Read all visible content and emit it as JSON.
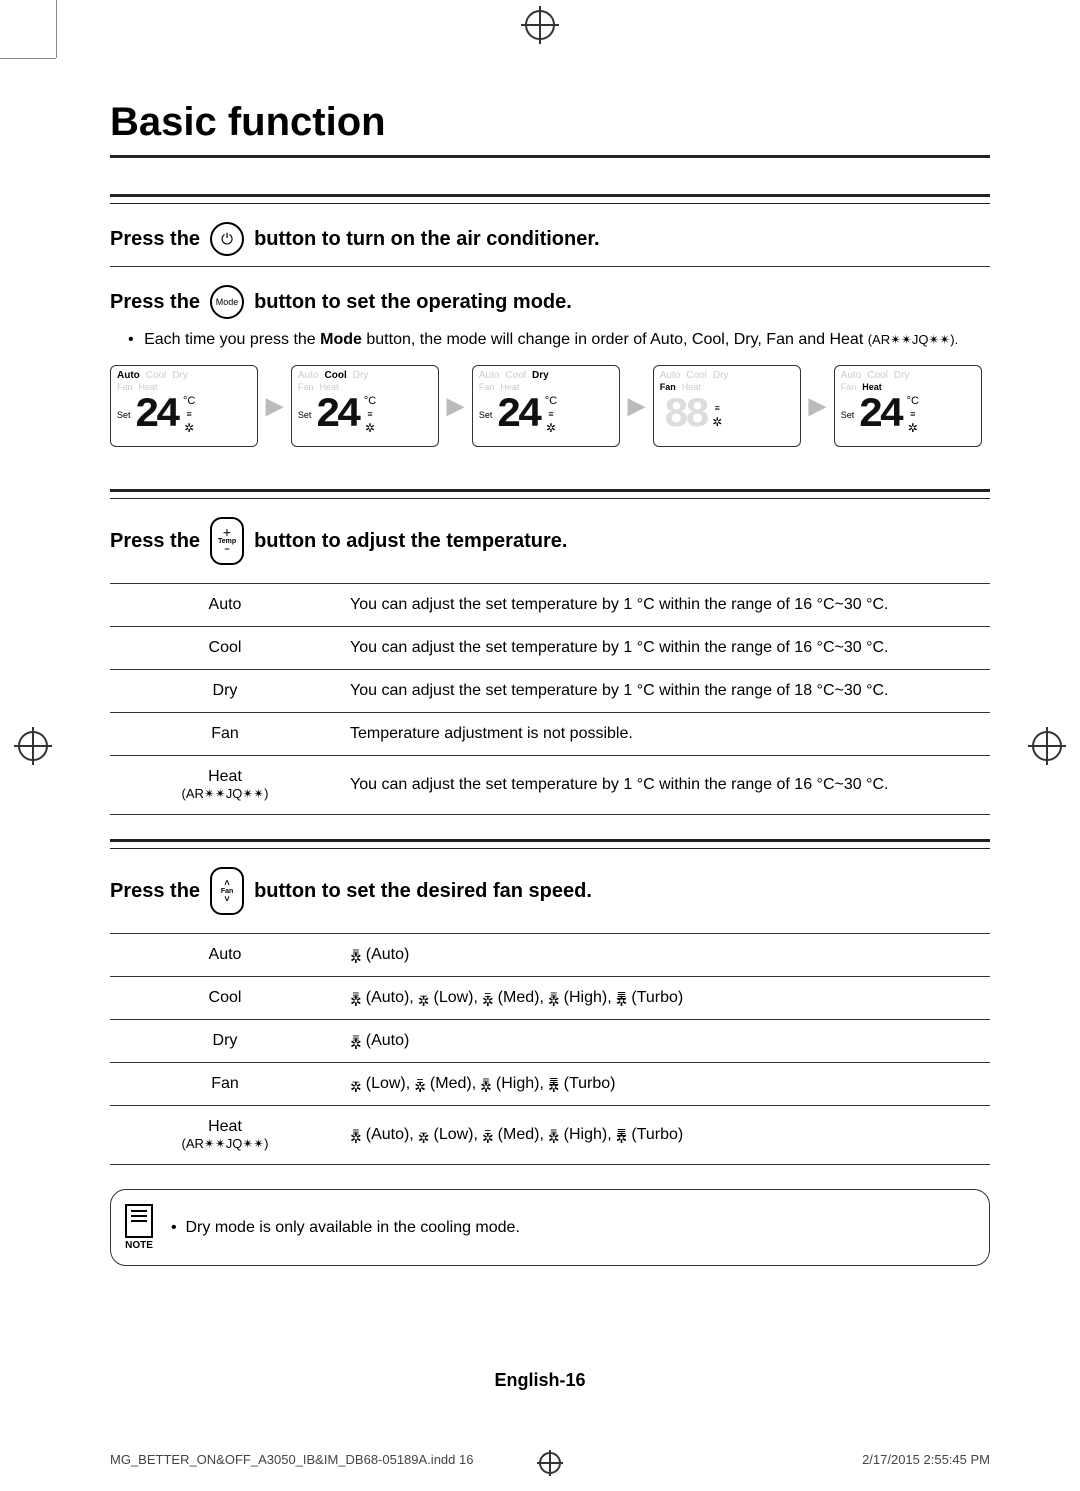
{
  "title": "Basic function",
  "step1": {
    "prefix": "Press the",
    "suffix": "button to turn on the air conditioner.",
    "icon": "⏻"
  },
  "step2": {
    "prefix": "Press the",
    "icon": "Mode",
    "suffix": "button to set the operating mode.",
    "note_prefix": "Each time you press the ",
    "note_bold": "Mode",
    "note_suffix": " button, the mode will change in order of Auto, Cool, Dry, Fan and Heat ",
    "note_model": "(AR✴✴JQ✴✴)."
  },
  "modes_sequence": {
    "all": [
      "Auto",
      "Cool",
      "Dry",
      "Fan",
      "Heat"
    ],
    "set_label": "Set",
    "temp": "24",
    "unit": "°C"
  },
  "step3": {
    "prefix": "Press the",
    "icon_top": "＋",
    "icon_mid": "Temp",
    "icon_bot": "−",
    "suffix": "button to adjust the temperature."
  },
  "temp_table": [
    {
      "mode": "Auto",
      "sub": "",
      "desc": "You can adjust the set temperature by 1 °C within the range of 16 °C~30 °C."
    },
    {
      "mode": "Cool",
      "sub": "",
      "desc": "You can adjust the set temperature by 1 °C within the range of 16 °C~30 °C."
    },
    {
      "mode": "Dry",
      "sub": "",
      "desc": "You can adjust the set temperature by 1 °C within the range of 18 °C~30 °C."
    },
    {
      "mode": "Fan",
      "sub": "",
      "desc": "Temperature adjustment is not possible."
    },
    {
      "mode": "Heat",
      "sub": "(AR✴✴JQ✴✴)",
      "desc": "You can adjust the set temperature by 1 °C within the range of 16 °C~30 °C."
    }
  ],
  "step4": {
    "prefix": "Press the",
    "icon_top": "˄",
    "icon_mid": "Fan",
    "icon_bot": "˅",
    "suffix": "button to set the desired fan speed."
  },
  "fan_labels": {
    "auto": "(Auto)",
    "low": "(Low)",
    "med": "(Med)",
    "high": "(High)",
    "turbo": "(Turbo)"
  },
  "fan_table": [
    {
      "mode": "Auto",
      "sub": "",
      "speeds": [
        "auto"
      ]
    },
    {
      "mode": "Cool",
      "sub": "",
      "speeds": [
        "auto",
        "low",
        "med",
        "high",
        "turbo"
      ]
    },
    {
      "mode": "Dry",
      "sub": "",
      "speeds": [
        "auto"
      ]
    },
    {
      "mode": "Fan",
      "sub": "",
      "speeds": [
        "low",
        "med",
        "high",
        "turbo"
      ]
    },
    {
      "mode": "Heat",
      "sub": "(AR✴✴JQ✴✴)",
      "speeds": [
        "auto",
        "low",
        "med",
        "high",
        "turbo"
      ]
    }
  ],
  "note": {
    "label": "NOTE",
    "text": "Dry mode is only available in the cooling mode."
  },
  "footer": "English-16",
  "print_footer": {
    "left": "MG_BETTER_ON&OFF_A3050_IB&IM_DB68-05189A.indd   16",
    "right": "2/17/2015   2:55:45 PM"
  }
}
